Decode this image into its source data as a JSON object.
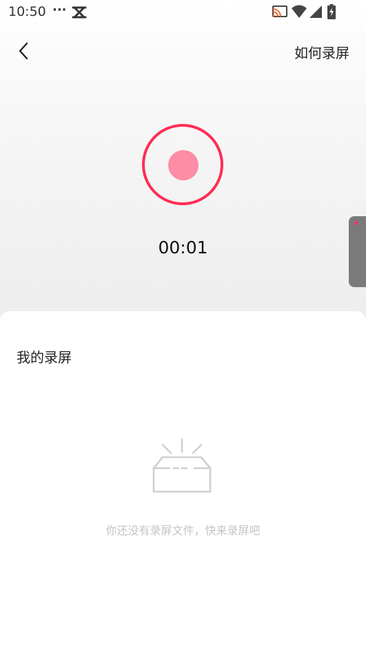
{
  "status_bar": {
    "time": "10:50",
    "dots": "···",
    "icons": [
      "capcut-app-icon",
      "cast-icon",
      "wifi-icon",
      "signal-icon",
      "battery-icon"
    ]
  },
  "nav": {
    "back_icon": "chevron-left-icon",
    "how_to_record_label": "如何录屏"
  },
  "recorder": {
    "timer": "00:01",
    "accent_color": "#ff2d55",
    "dot_color": "#fd8ca4"
  },
  "recordings": {
    "section_title": "我的录屏",
    "empty_icon": "empty-box-icon",
    "empty_message": "你还没有录屏文件，快来录屏吧"
  }
}
